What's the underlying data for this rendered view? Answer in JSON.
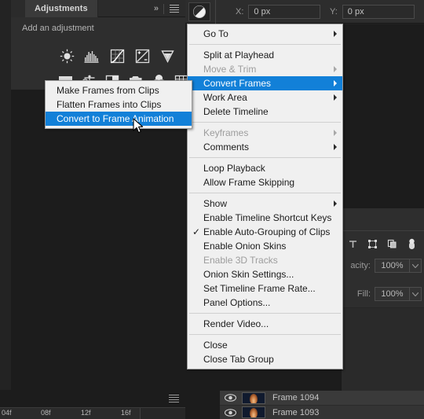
{
  "adjustments_panel": {
    "tab_label": "Adjustments",
    "collapse_icon": "chevron-double-right-icon",
    "menu_icon": "panel-menu-icon",
    "hint_label": "Add an adjustment",
    "icons_row1": [
      "brightness-contrast-icon",
      "levels-icon",
      "curves-icon",
      "exposure-icon",
      "vibrance-icon"
    ],
    "icons_row2": [
      "gradient-map-icon",
      "color-balance-icon",
      "black-and-white-icon",
      "photo-filter-icon",
      "channel-mixer-icon",
      "color-lookup-icon"
    ]
  },
  "options_bar": {
    "tool_icon": "gradient-tool-icon",
    "x_label": "X:",
    "x_value": "0 px",
    "y_label": "Y:",
    "y_value": "0 px"
  },
  "layers_panel": {
    "expand_icon": "triangle-right-icon",
    "lock_icons": [
      "lock-transparent-pixels-icon",
      "lock-position-icon",
      "lock-artboard-icon",
      "lock-all-icon"
    ],
    "opacity_label": "acity:",
    "opacity_value": "100%",
    "fill_label": "Fill:",
    "fill_value": "100%",
    "dropdown_icon": "chevron-down-icon",
    "rows": [
      {
        "visibility_icon": "eye-icon",
        "thumbnail": "layer-thumbnail",
        "name": "Frame 1094"
      },
      {
        "visibility_icon": "eye-icon",
        "thumbnail": "layer-thumbnail",
        "name": "Frame 1093"
      }
    ]
  },
  "timeline": {
    "menu_icon": "timeline-panel-menu-icon",
    "ruler_ticks": [
      "04f",
      "08f",
      "12f",
      "16f"
    ]
  },
  "context_menu": {
    "items": [
      {
        "label": "Go To",
        "submenu": true,
        "disabled": false,
        "checked": false,
        "selected": false
      },
      {
        "separator": true
      },
      {
        "label": "Split at Playhead",
        "submenu": false,
        "disabled": false,
        "checked": false,
        "selected": false
      },
      {
        "label": "Move & Trim",
        "submenu": true,
        "disabled": true,
        "checked": false,
        "selected": false
      },
      {
        "label": "Convert Frames",
        "submenu": true,
        "disabled": false,
        "checked": false,
        "selected": true
      },
      {
        "label": "Work Area",
        "submenu": true,
        "disabled": false,
        "checked": false,
        "selected": false
      },
      {
        "label": "Delete Timeline",
        "submenu": false,
        "disabled": false,
        "checked": false,
        "selected": false
      },
      {
        "separator": true
      },
      {
        "label": "Keyframes",
        "submenu": true,
        "disabled": true,
        "checked": false,
        "selected": false
      },
      {
        "label": "Comments",
        "submenu": true,
        "disabled": false,
        "checked": false,
        "selected": false
      },
      {
        "separator": true
      },
      {
        "label": "Loop Playback",
        "submenu": false,
        "disabled": false,
        "checked": false,
        "selected": false
      },
      {
        "label": "Allow Frame Skipping",
        "submenu": false,
        "disabled": false,
        "checked": false,
        "selected": false
      },
      {
        "separator": true
      },
      {
        "label": "Show",
        "submenu": true,
        "disabled": false,
        "checked": false,
        "selected": false
      },
      {
        "label": "Enable Timeline Shortcut Keys",
        "submenu": false,
        "disabled": false,
        "checked": false,
        "selected": false
      },
      {
        "label": "Enable Auto-Grouping of Clips",
        "submenu": false,
        "disabled": false,
        "checked": true,
        "selected": false
      },
      {
        "label": "Enable Onion Skins",
        "submenu": false,
        "disabled": false,
        "checked": false,
        "selected": false
      },
      {
        "label": "Enable 3D Tracks",
        "submenu": false,
        "disabled": true,
        "checked": false,
        "selected": false
      },
      {
        "label": "Onion Skin Settings...",
        "submenu": false,
        "disabled": false,
        "checked": false,
        "selected": false
      },
      {
        "label": "Set Timeline Frame Rate...",
        "submenu": false,
        "disabled": false,
        "checked": false,
        "selected": false
      },
      {
        "label": "Panel Options...",
        "submenu": false,
        "disabled": false,
        "checked": false,
        "selected": false
      },
      {
        "separator": true
      },
      {
        "label": "Render Video...",
        "submenu": false,
        "disabled": false,
        "checked": false,
        "selected": false
      },
      {
        "separator": true
      },
      {
        "label": "Close",
        "submenu": false,
        "disabled": false,
        "checked": false,
        "selected": false
      },
      {
        "label": "Close Tab Group",
        "submenu": false,
        "disabled": false,
        "checked": false,
        "selected": false
      }
    ]
  },
  "submenu": {
    "items": [
      {
        "label": "Make Frames from Clips",
        "selected": false
      },
      {
        "label": "Flatten Frames into Clips",
        "selected": false
      },
      {
        "label": "Convert to Frame Animation",
        "selected": true
      }
    ]
  },
  "colors": {
    "menu_background": "#f0f0f0",
    "menu_highlight": "#1280d8",
    "menu_text": "#1b1b1b",
    "menu_text_disabled": "#9d9d9d",
    "panel_background": "#2e2e2e",
    "canvas_background": "#1c1c1c"
  },
  "cursor": {
    "icon": "mouse-pointer-icon"
  }
}
